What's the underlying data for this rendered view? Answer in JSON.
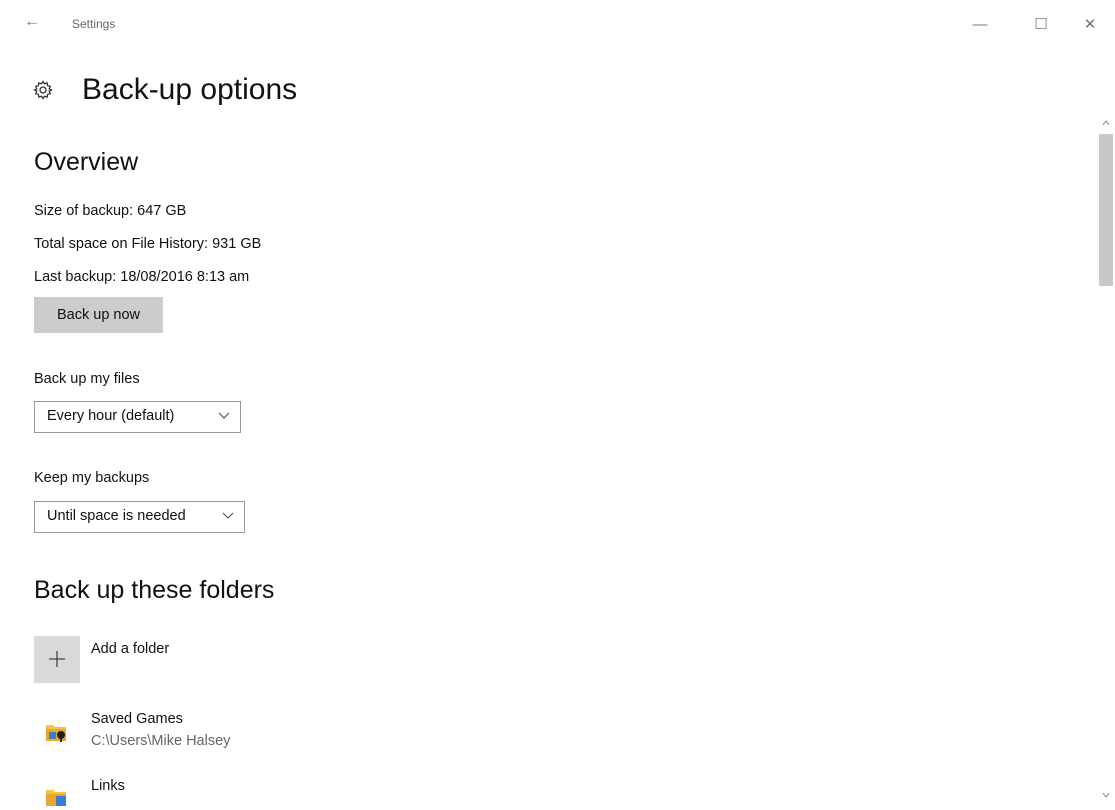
{
  "window": {
    "title": "Settings",
    "back_icon": "back-arrow-icon",
    "minimize_glyph": "—",
    "maximize_glyph": "☐",
    "close_glyph": "✕",
    "back_glyph": "←"
  },
  "page": {
    "title": "Back-up options",
    "title_icon": "gear-icon"
  },
  "overview": {
    "heading": "Overview",
    "size_text": "Size of backup: 647 GB",
    "total_text": "Total space on File History: 931 GB",
    "last_text": "Last backup: 18/08/2016 8:13 am",
    "backup_button": "Back up now"
  },
  "frequency": {
    "label": "Back up my files",
    "selected": "Every hour (default)"
  },
  "retention": {
    "label": "Keep my backups",
    "selected": "Until space is needed"
  },
  "folders": {
    "heading": "Back up these folders",
    "add_label": "Add a folder",
    "items": [
      {
        "name": "Saved Games",
        "path": "C:\\Users\\Mike Halsey",
        "icon": "saved-games-folder-icon"
      },
      {
        "name": "Links",
        "path": "",
        "icon": "links-folder-icon"
      }
    ]
  },
  "colors": {
    "button_bg": "#cccccc",
    "add_tile_bg": "#d9d9d9",
    "scroll_thumb": "#c8c8c8",
    "path_text": "#666666"
  }
}
